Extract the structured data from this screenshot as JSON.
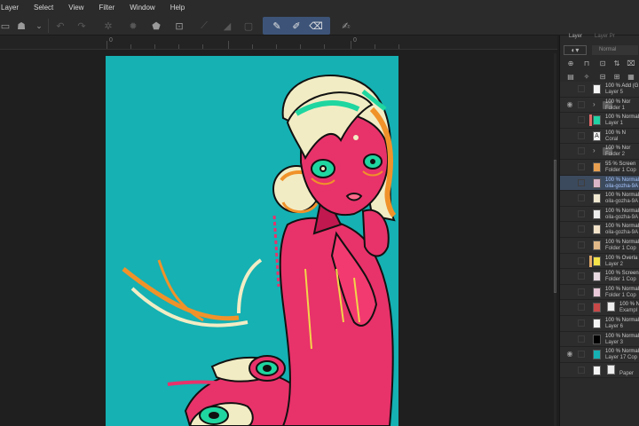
{
  "menu": [
    "Layer",
    "Select",
    "View",
    "Filter",
    "Window",
    "Help"
  ],
  "ruler_labels": [
    "0",
    "0"
  ],
  "layer_panel": {
    "tabs": [
      "Layer",
      "Layer Pr"
    ],
    "blend_mode": "Normal"
  },
  "layers": [
    {
      "line1": "100 % Add (G",
      "line2": "Layer 5",
      "visible": false,
      "thumb": "white"
    },
    {
      "line1": "100 % Nor",
      "line2": "Folder 1",
      "visible": true,
      "folder": true
    },
    {
      "line1": "100 % Normal",
      "line2": "Layer 1",
      "visible": false,
      "thumb": "#22d1a4",
      "bar": "#e36868"
    },
    {
      "line1": "100 % N",
      "line2": "Coral",
      "visible": false,
      "thumb": "white",
      "text_layer": true
    },
    {
      "line1": "100 % Nor",
      "line2": "Folder 2",
      "visible": false,
      "folder": true
    },
    {
      "line1": "55 % Screen",
      "line2": "Folder 1 Cop",
      "visible": false,
      "thumb": "#e8a050"
    },
    {
      "line1": "100 % Normal",
      "line2": "oila-gozha-9A",
      "visible": false,
      "thumb": "#d9b5c8",
      "selected": true
    },
    {
      "line1": "100 % Normal",
      "line2": "oila-gozha-9A",
      "visible": false,
      "thumb": "#f0e8d0"
    },
    {
      "line1": "100 % Normal",
      "line2": "oila-gozha-9A",
      "visible": false,
      "thumb": "#eeeeee"
    },
    {
      "line1": "100 % Normal",
      "line2": "oila-gozha-9A",
      "visible": false,
      "thumb": "#f2e2c8"
    },
    {
      "line1": "100 % Normal",
      "line2": "Folder 1 Cop",
      "visible": false,
      "thumb": "#e0b888"
    },
    {
      "line1": "100 % Overla",
      "line2": "Layer 2",
      "visible": false,
      "thumb": "#f5e34a",
      "bar": "#e3a868"
    },
    {
      "line1": "100 % Screen",
      "line2": "Folder 1 Cop",
      "visible": false,
      "thumb": "#e8d8e0"
    },
    {
      "line1": "100 % Normal",
      "line2": "Folder 1 Cop",
      "visible": false,
      "thumb": "#e8c8d8"
    },
    {
      "line1": "100 % N",
      "line2": "Exampl",
      "visible": false,
      "thumb": "#c94848",
      "mask": true
    },
    {
      "line1": "100 % Normal",
      "line2": "Layer 6",
      "visible": false,
      "thumb": "white"
    },
    {
      "line1": "100 % Normal",
      "line2": "Layer 3",
      "visible": false,
      "thumb": "#000000"
    },
    {
      "line1": "100 % Normal",
      "line2": "Layer 17 Cop",
      "visible": true,
      "thumb": "#15b1b3"
    },
    {
      "line1": "",
      "line2": "Paper",
      "visible": false,
      "thumb": "white",
      "mask": true
    }
  ],
  "colors": {
    "canvas_bg": "#15b1b3",
    "skin": "#e8326a",
    "hair": "#f2ecc4",
    "accent_green": "#1fd6a0",
    "accent_orange": "#f0922a",
    "selection": "#3d5478"
  }
}
